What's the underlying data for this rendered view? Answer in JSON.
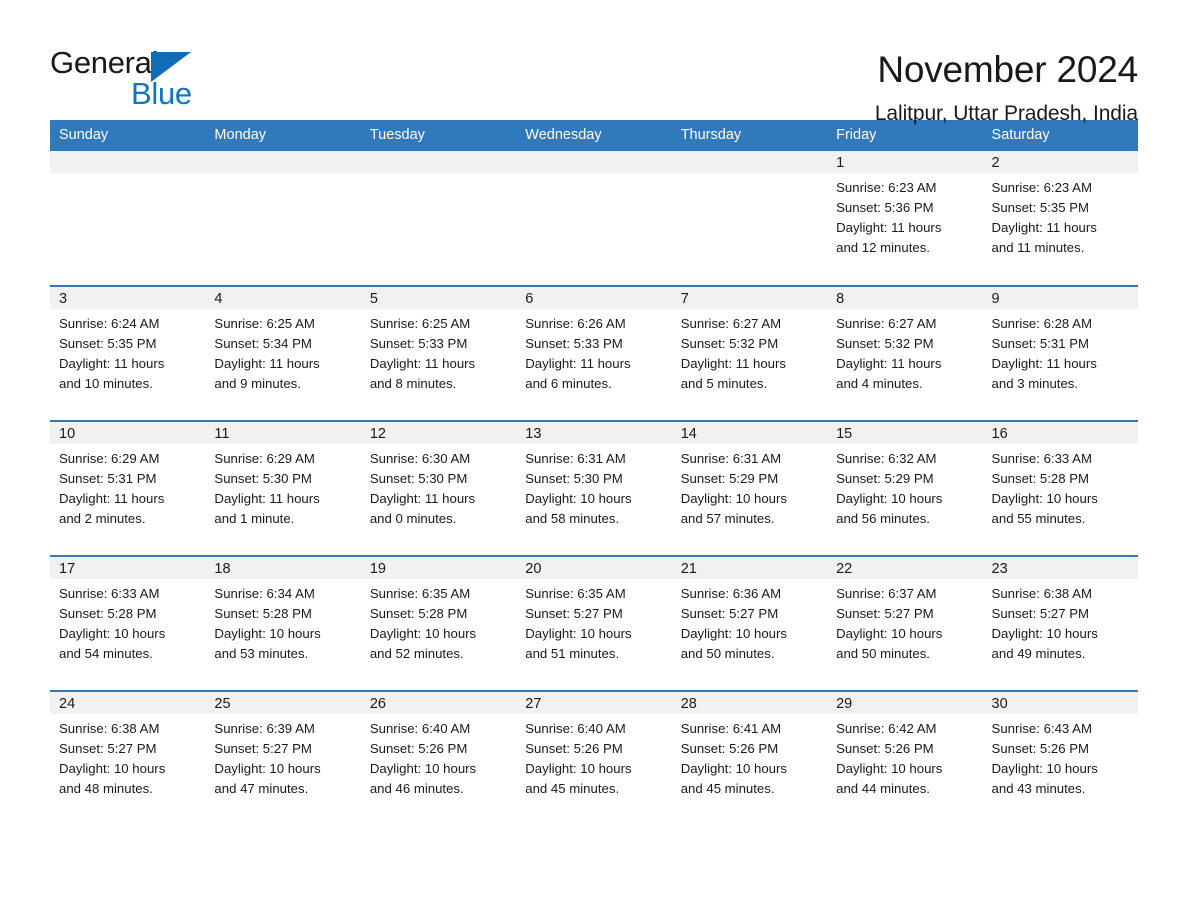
{
  "brand": {
    "name_part1": "General",
    "name_part2": "Blue",
    "triangle_icon": "triangle-icon",
    "accent_color": "#1076c4"
  },
  "header": {
    "title": "November 2024",
    "subtitle": "Lalitpur, Uttar Pradesh, India"
  },
  "colors": {
    "header_blue": "#2f79bc",
    "daynum_gray": "#f1f1f1",
    "text": "#1a1a1a"
  },
  "weekday_headers": [
    "Sunday",
    "Monday",
    "Tuesday",
    "Wednesday",
    "Thursday",
    "Friday",
    "Saturday"
  ],
  "weeks": [
    [
      {
        "day": "",
        "empty": true
      },
      {
        "day": "",
        "empty": true
      },
      {
        "day": "",
        "empty": true
      },
      {
        "day": "",
        "empty": true
      },
      {
        "day": "",
        "empty": true
      },
      {
        "day": "1",
        "sunrise": "Sunrise: 6:23 AM",
        "sunset": "Sunset: 5:36 PM",
        "daylight_l1": "Daylight: 11 hours",
        "daylight_l2": "and 12 minutes."
      },
      {
        "day": "2",
        "sunrise": "Sunrise: 6:23 AM",
        "sunset": "Sunset: 5:35 PM",
        "daylight_l1": "Daylight: 11 hours",
        "daylight_l2": "and 11 minutes."
      }
    ],
    [
      {
        "day": "3",
        "sunrise": "Sunrise: 6:24 AM",
        "sunset": "Sunset: 5:35 PM",
        "daylight_l1": "Daylight: 11 hours",
        "daylight_l2": "and 10 minutes."
      },
      {
        "day": "4",
        "sunrise": "Sunrise: 6:25 AM",
        "sunset": "Sunset: 5:34 PM",
        "daylight_l1": "Daylight: 11 hours",
        "daylight_l2": "and 9 minutes."
      },
      {
        "day": "5",
        "sunrise": "Sunrise: 6:25 AM",
        "sunset": "Sunset: 5:33 PM",
        "daylight_l1": "Daylight: 11 hours",
        "daylight_l2": "and 8 minutes."
      },
      {
        "day": "6",
        "sunrise": "Sunrise: 6:26 AM",
        "sunset": "Sunset: 5:33 PM",
        "daylight_l1": "Daylight: 11 hours",
        "daylight_l2": "and 6 minutes."
      },
      {
        "day": "7",
        "sunrise": "Sunrise: 6:27 AM",
        "sunset": "Sunset: 5:32 PM",
        "daylight_l1": "Daylight: 11 hours",
        "daylight_l2": "and 5 minutes."
      },
      {
        "day": "8",
        "sunrise": "Sunrise: 6:27 AM",
        "sunset": "Sunset: 5:32 PM",
        "daylight_l1": "Daylight: 11 hours",
        "daylight_l2": "and 4 minutes."
      },
      {
        "day": "9",
        "sunrise": "Sunrise: 6:28 AM",
        "sunset": "Sunset: 5:31 PM",
        "daylight_l1": "Daylight: 11 hours",
        "daylight_l2": "and 3 minutes."
      }
    ],
    [
      {
        "day": "10",
        "sunrise": "Sunrise: 6:29 AM",
        "sunset": "Sunset: 5:31 PM",
        "daylight_l1": "Daylight: 11 hours",
        "daylight_l2": "and 2 minutes."
      },
      {
        "day": "11",
        "sunrise": "Sunrise: 6:29 AM",
        "sunset": "Sunset: 5:30 PM",
        "daylight_l1": "Daylight: 11 hours",
        "daylight_l2": "and 1 minute."
      },
      {
        "day": "12",
        "sunrise": "Sunrise: 6:30 AM",
        "sunset": "Sunset: 5:30 PM",
        "daylight_l1": "Daylight: 11 hours",
        "daylight_l2": "and 0 minutes."
      },
      {
        "day": "13",
        "sunrise": "Sunrise: 6:31 AM",
        "sunset": "Sunset: 5:30 PM",
        "daylight_l1": "Daylight: 10 hours",
        "daylight_l2": "and 58 minutes."
      },
      {
        "day": "14",
        "sunrise": "Sunrise: 6:31 AM",
        "sunset": "Sunset: 5:29 PM",
        "daylight_l1": "Daylight: 10 hours",
        "daylight_l2": "and 57 minutes."
      },
      {
        "day": "15",
        "sunrise": "Sunrise: 6:32 AM",
        "sunset": "Sunset: 5:29 PM",
        "daylight_l1": "Daylight: 10 hours",
        "daylight_l2": "and 56 minutes."
      },
      {
        "day": "16",
        "sunrise": "Sunrise: 6:33 AM",
        "sunset": "Sunset: 5:28 PM",
        "daylight_l1": "Daylight: 10 hours",
        "daylight_l2": "and 55 minutes."
      }
    ],
    [
      {
        "day": "17",
        "sunrise": "Sunrise: 6:33 AM",
        "sunset": "Sunset: 5:28 PM",
        "daylight_l1": "Daylight: 10 hours",
        "daylight_l2": "and 54 minutes."
      },
      {
        "day": "18",
        "sunrise": "Sunrise: 6:34 AM",
        "sunset": "Sunset: 5:28 PM",
        "daylight_l1": "Daylight: 10 hours",
        "daylight_l2": "and 53 minutes."
      },
      {
        "day": "19",
        "sunrise": "Sunrise: 6:35 AM",
        "sunset": "Sunset: 5:28 PM",
        "daylight_l1": "Daylight: 10 hours",
        "daylight_l2": "and 52 minutes."
      },
      {
        "day": "20",
        "sunrise": "Sunrise: 6:35 AM",
        "sunset": "Sunset: 5:27 PM",
        "daylight_l1": "Daylight: 10 hours",
        "daylight_l2": "and 51 minutes."
      },
      {
        "day": "21",
        "sunrise": "Sunrise: 6:36 AM",
        "sunset": "Sunset: 5:27 PM",
        "daylight_l1": "Daylight: 10 hours",
        "daylight_l2": "and 50 minutes."
      },
      {
        "day": "22",
        "sunrise": "Sunrise: 6:37 AM",
        "sunset": "Sunset: 5:27 PM",
        "daylight_l1": "Daylight: 10 hours",
        "daylight_l2": "and 50 minutes."
      },
      {
        "day": "23",
        "sunrise": "Sunrise: 6:38 AM",
        "sunset": "Sunset: 5:27 PM",
        "daylight_l1": "Daylight: 10 hours",
        "daylight_l2": "and 49 minutes."
      }
    ],
    [
      {
        "day": "24",
        "sunrise": "Sunrise: 6:38 AM",
        "sunset": "Sunset: 5:27 PM",
        "daylight_l1": "Daylight: 10 hours",
        "daylight_l2": "and 48 minutes."
      },
      {
        "day": "25",
        "sunrise": "Sunrise: 6:39 AM",
        "sunset": "Sunset: 5:27 PM",
        "daylight_l1": "Daylight: 10 hours",
        "daylight_l2": "and 47 minutes."
      },
      {
        "day": "26",
        "sunrise": "Sunrise: 6:40 AM",
        "sunset": "Sunset: 5:26 PM",
        "daylight_l1": "Daylight: 10 hours",
        "daylight_l2": "and 46 minutes."
      },
      {
        "day": "27",
        "sunrise": "Sunrise: 6:40 AM",
        "sunset": "Sunset: 5:26 PM",
        "daylight_l1": "Daylight: 10 hours",
        "daylight_l2": "and 45 minutes."
      },
      {
        "day": "28",
        "sunrise": "Sunrise: 6:41 AM",
        "sunset": "Sunset: 5:26 PM",
        "daylight_l1": "Daylight: 10 hours",
        "daylight_l2": "and 45 minutes."
      },
      {
        "day": "29",
        "sunrise": "Sunrise: 6:42 AM",
        "sunset": "Sunset: 5:26 PM",
        "daylight_l1": "Daylight: 10 hours",
        "daylight_l2": "and 44 minutes."
      },
      {
        "day": "30",
        "sunrise": "Sunrise: 6:43 AM",
        "sunset": "Sunset: 5:26 PM",
        "daylight_l1": "Daylight: 10 hours",
        "daylight_l2": "and 43 minutes."
      }
    ]
  ]
}
